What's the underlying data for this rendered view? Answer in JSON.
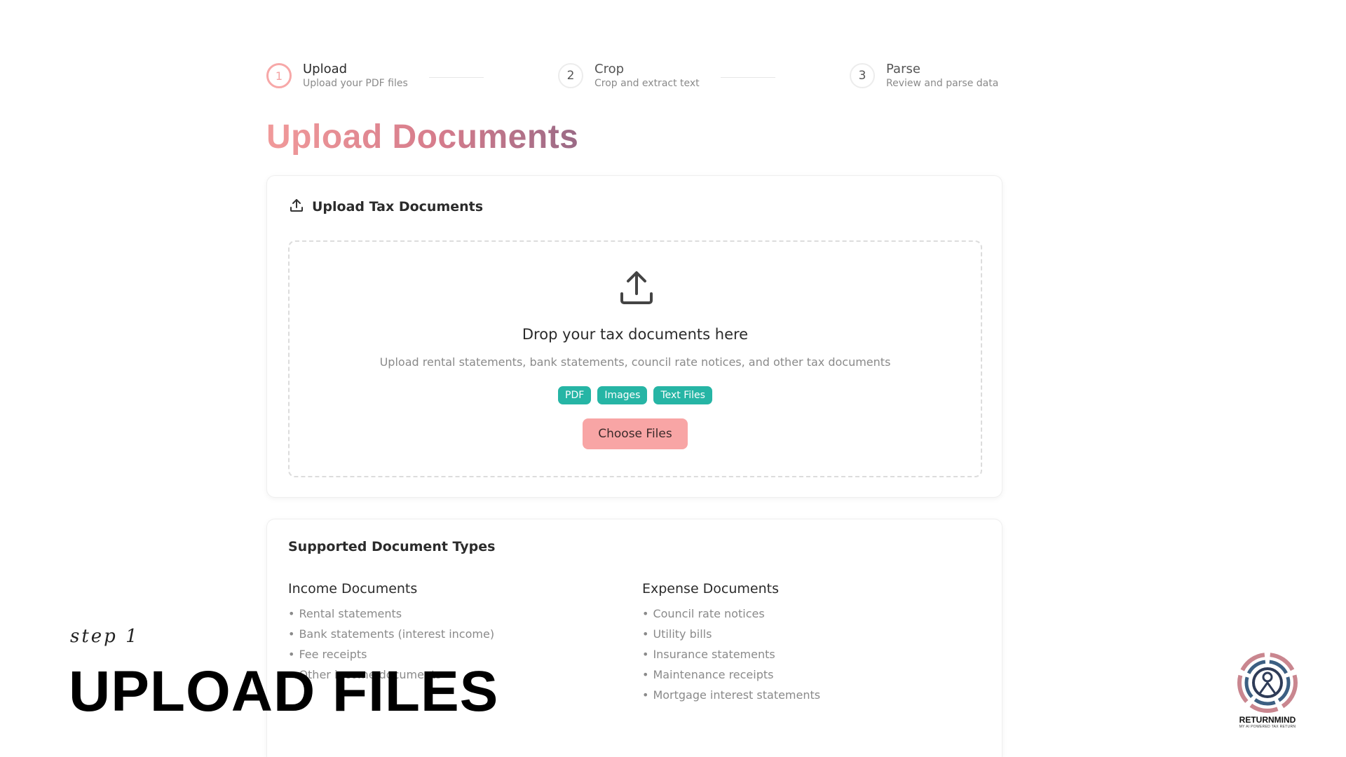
{
  "stepper": {
    "steps": [
      {
        "number": "1",
        "title": "Upload",
        "subtitle": "Upload your PDF files"
      },
      {
        "number": "2",
        "title": "Crop",
        "subtitle": "Crop and extract text"
      },
      {
        "number": "3",
        "title": "Parse",
        "subtitle": "Review and parse data"
      }
    ]
  },
  "page": {
    "title": "Upload Documents"
  },
  "upload_card": {
    "icon": "upload-icon",
    "title": "Upload Tax Documents",
    "dropzone": {
      "icon": "upload-tray-icon",
      "title": "Drop your tax documents here",
      "subtitle": "Upload rental statements, bank statements, council rate notices, and other tax documents",
      "badges": [
        "PDF",
        "Images",
        "Text Files"
      ],
      "button_label": "Choose Files"
    }
  },
  "supported": {
    "title": "Supported Document Types",
    "income": {
      "title": "Income Documents",
      "items": [
        "Rental statements",
        "Bank statements (interest income)",
        "Fee receipts",
        "Other income documents"
      ]
    },
    "expense": {
      "title": "Expense Documents",
      "items": [
        "Council rate notices",
        "Utility bills",
        "Insurance statements",
        "Maintenance receipts",
        "Mortgage interest statements"
      ]
    }
  },
  "caption": {
    "step": "step 1",
    "title": "UPLOAD FILES"
  },
  "logo": {
    "name": "RETURNMIND",
    "tagline": "MY AI POWERED TAX RETURN"
  },
  "colors": {
    "accent": "#f8a5a5",
    "badge": "#26b5a5",
    "title_gradient_start": "#f19a9a",
    "title_gradient_end": "#9a6a86"
  }
}
